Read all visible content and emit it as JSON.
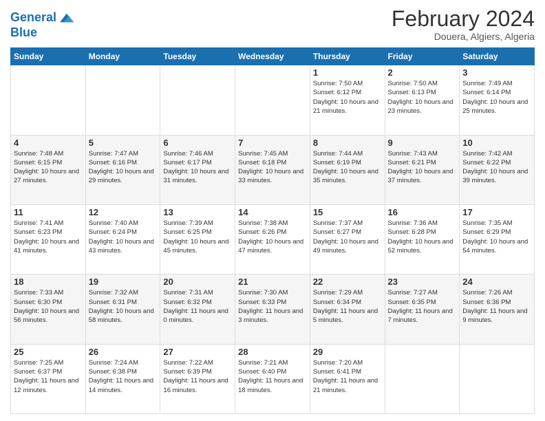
{
  "logo": {
    "line1": "General",
    "line2": "Blue"
  },
  "title": "February 2024",
  "location": "Douera, Algiers, Algeria",
  "days_of_week": [
    "Sunday",
    "Monday",
    "Tuesday",
    "Wednesday",
    "Thursday",
    "Friday",
    "Saturday"
  ],
  "weeks": [
    [
      {
        "day": "",
        "sunrise": "",
        "sunset": "",
        "daylight": ""
      },
      {
        "day": "",
        "sunrise": "",
        "sunset": "",
        "daylight": ""
      },
      {
        "day": "",
        "sunrise": "",
        "sunset": "",
        "daylight": ""
      },
      {
        "day": "",
        "sunrise": "",
        "sunset": "",
        "daylight": ""
      },
      {
        "day": "1",
        "sunrise": "Sunrise: 7:50 AM",
        "sunset": "Sunset: 6:12 PM",
        "daylight": "Daylight: 10 hours and 21 minutes."
      },
      {
        "day": "2",
        "sunrise": "Sunrise: 7:50 AM",
        "sunset": "Sunset: 6:13 PM",
        "daylight": "Daylight: 10 hours and 23 minutes."
      },
      {
        "day": "3",
        "sunrise": "Sunrise: 7:49 AM",
        "sunset": "Sunset: 6:14 PM",
        "daylight": "Daylight: 10 hours and 25 minutes."
      }
    ],
    [
      {
        "day": "4",
        "sunrise": "Sunrise: 7:48 AM",
        "sunset": "Sunset: 6:15 PM",
        "daylight": "Daylight: 10 hours and 27 minutes."
      },
      {
        "day": "5",
        "sunrise": "Sunrise: 7:47 AM",
        "sunset": "Sunset: 6:16 PM",
        "daylight": "Daylight: 10 hours and 29 minutes."
      },
      {
        "day": "6",
        "sunrise": "Sunrise: 7:46 AM",
        "sunset": "Sunset: 6:17 PM",
        "daylight": "Daylight: 10 hours and 31 minutes."
      },
      {
        "day": "7",
        "sunrise": "Sunrise: 7:45 AM",
        "sunset": "Sunset: 6:18 PM",
        "daylight": "Daylight: 10 hours and 33 minutes."
      },
      {
        "day": "8",
        "sunrise": "Sunrise: 7:44 AM",
        "sunset": "Sunset: 6:19 PM",
        "daylight": "Daylight: 10 hours and 35 minutes."
      },
      {
        "day": "9",
        "sunrise": "Sunrise: 7:43 AM",
        "sunset": "Sunset: 6:21 PM",
        "daylight": "Daylight: 10 hours and 37 minutes."
      },
      {
        "day": "10",
        "sunrise": "Sunrise: 7:42 AM",
        "sunset": "Sunset: 6:22 PM",
        "daylight": "Daylight: 10 hours and 39 minutes."
      }
    ],
    [
      {
        "day": "11",
        "sunrise": "Sunrise: 7:41 AM",
        "sunset": "Sunset: 6:23 PM",
        "daylight": "Daylight: 10 hours and 41 minutes."
      },
      {
        "day": "12",
        "sunrise": "Sunrise: 7:40 AM",
        "sunset": "Sunset: 6:24 PM",
        "daylight": "Daylight: 10 hours and 43 minutes."
      },
      {
        "day": "13",
        "sunrise": "Sunrise: 7:39 AM",
        "sunset": "Sunset: 6:25 PM",
        "daylight": "Daylight: 10 hours and 45 minutes."
      },
      {
        "day": "14",
        "sunrise": "Sunrise: 7:38 AM",
        "sunset": "Sunset: 6:26 PM",
        "daylight": "Daylight: 10 hours and 47 minutes."
      },
      {
        "day": "15",
        "sunrise": "Sunrise: 7:37 AM",
        "sunset": "Sunset: 6:27 PM",
        "daylight": "Daylight: 10 hours and 49 minutes."
      },
      {
        "day": "16",
        "sunrise": "Sunrise: 7:36 AM",
        "sunset": "Sunset: 6:28 PM",
        "daylight": "Daylight: 10 hours and 52 minutes."
      },
      {
        "day": "17",
        "sunrise": "Sunrise: 7:35 AM",
        "sunset": "Sunset: 6:29 PM",
        "daylight": "Daylight: 10 hours and 54 minutes."
      }
    ],
    [
      {
        "day": "18",
        "sunrise": "Sunrise: 7:33 AM",
        "sunset": "Sunset: 6:30 PM",
        "daylight": "Daylight: 10 hours and 56 minutes."
      },
      {
        "day": "19",
        "sunrise": "Sunrise: 7:32 AM",
        "sunset": "Sunset: 6:31 PM",
        "daylight": "Daylight: 10 hours and 58 minutes."
      },
      {
        "day": "20",
        "sunrise": "Sunrise: 7:31 AM",
        "sunset": "Sunset: 6:32 PM",
        "daylight": "Daylight: 11 hours and 0 minutes."
      },
      {
        "day": "21",
        "sunrise": "Sunrise: 7:30 AM",
        "sunset": "Sunset: 6:33 PM",
        "daylight": "Daylight: 11 hours and 3 minutes."
      },
      {
        "day": "22",
        "sunrise": "Sunrise: 7:29 AM",
        "sunset": "Sunset: 6:34 PM",
        "daylight": "Daylight: 11 hours and 5 minutes."
      },
      {
        "day": "23",
        "sunrise": "Sunrise: 7:27 AM",
        "sunset": "Sunset: 6:35 PM",
        "daylight": "Daylight: 11 hours and 7 minutes."
      },
      {
        "day": "24",
        "sunrise": "Sunrise: 7:26 AM",
        "sunset": "Sunset: 6:36 PM",
        "daylight": "Daylight: 11 hours and 9 minutes."
      }
    ],
    [
      {
        "day": "25",
        "sunrise": "Sunrise: 7:25 AM",
        "sunset": "Sunset: 6:37 PM",
        "daylight": "Daylight: 11 hours and 12 minutes."
      },
      {
        "day": "26",
        "sunrise": "Sunrise: 7:24 AM",
        "sunset": "Sunset: 6:38 PM",
        "daylight": "Daylight: 11 hours and 14 minutes."
      },
      {
        "day": "27",
        "sunrise": "Sunrise: 7:22 AM",
        "sunset": "Sunset: 6:39 PM",
        "daylight": "Daylight: 11 hours and 16 minutes."
      },
      {
        "day": "28",
        "sunrise": "Sunrise: 7:21 AM",
        "sunset": "Sunset: 6:40 PM",
        "daylight": "Daylight: 11 hours and 18 minutes."
      },
      {
        "day": "29",
        "sunrise": "Sunrise: 7:20 AM",
        "sunset": "Sunset: 6:41 PM",
        "daylight": "Daylight: 11 hours and 21 minutes."
      },
      {
        "day": "",
        "sunrise": "",
        "sunset": "",
        "daylight": ""
      },
      {
        "day": "",
        "sunrise": "",
        "sunset": "",
        "daylight": ""
      }
    ]
  ]
}
